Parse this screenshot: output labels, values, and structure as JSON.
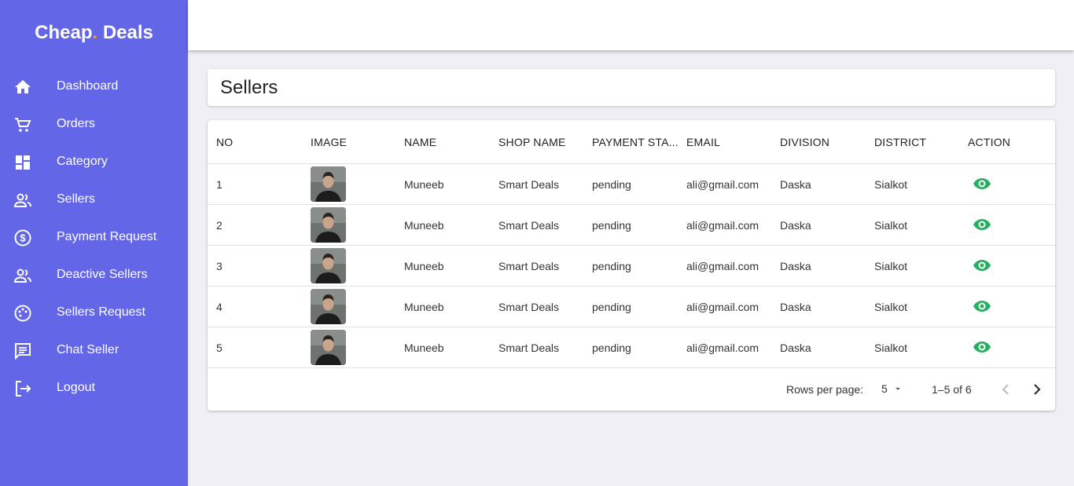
{
  "brand": {
    "part1": "Cheap",
    "dot": ".",
    "part2": " Deals"
  },
  "colors": {
    "sidebar": "#6366e6",
    "accent_dot": "#f59e0b",
    "view_icon": "#27ae60"
  },
  "sidebar": {
    "items": [
      {
        "label": "Dashboard",
        "icon": "home-icon"
      },
      {
        "label": "Orders",
        "icon": "cart-icon"
      },
      {
        "label": "Category",
        "icon": "dashboard-grid-icon"
      },
      {
        "label": "Sellers",
        "icon": "people-icon"
      },
      {
        "label": "Payment Request",
        "icon": "dollar-circle-icon"
      },
      {
        "label": "Deactive Sellers",
        "icon": "people-icon"
      },
      {
        "label": "Sellers Request",
        "icon": "palette-icon"
      },
      {
        "label": "Chat Seller",
        "icon": "chat-icon"
      },
      {
        "label": "Logout",
        "icon": "logout-icon"
      }
    ]
  },
  "page": {
    "title": "Sellers"
  },
  "table": {
    "headers": [
      "NO",
      "IMAGE",
      "NAME",
      "SHOP NAME",
      "PAYMENT STA...",
      "EMAIL",
      "DIVISION",
      "DISTRICT",
      "ACTION"
    ],
    "rows": [
      {
        "no": "1",
        "name": "Muneeb",
        "shop": "Smart Deals",
        "payment": "pending",
        "email": "ali@gmail.com",
        "division": "Daska",
        "district": "Sialkot"
      },
      {
        "no": "2",
        "name": "Muneeb",
        "shop": "Smart Deals",
        "payment": "pending",
        "email": "ali@gmail.com",
        "division": "Daska",
        "district": "Sialkot"
      },
      {
        "no": "3",
        "name": "Muneeb",
        "shop": "Smart Deals",
        "payment": "pending",
        "email": "ali@gmail.com",
        "division": "Daska",
        "district": "Sialkot"
      },
      {
        "no": "4",
        "name": "Muneeb",
        "shop": "Smart Deals",
        "payment": "pending",
        "email": "ali@gmail.com",
        "division": "Daska",
        "district": "Sialkot"
      },
      {
        "no": "5",
        "name": "Muneeb",
        "shop": "Smart Deals",
        "payment": "pending",
        "email": "ali@gmail.com",
        "division": "Daska",
        "district": "Sialkot"
      }
    ]
  },
  "pagination": {
    "rows_per_page_label": "Rows per page:",
    "rows_per_page": "5",
    "range": "1–5 of 6"
  }
}
